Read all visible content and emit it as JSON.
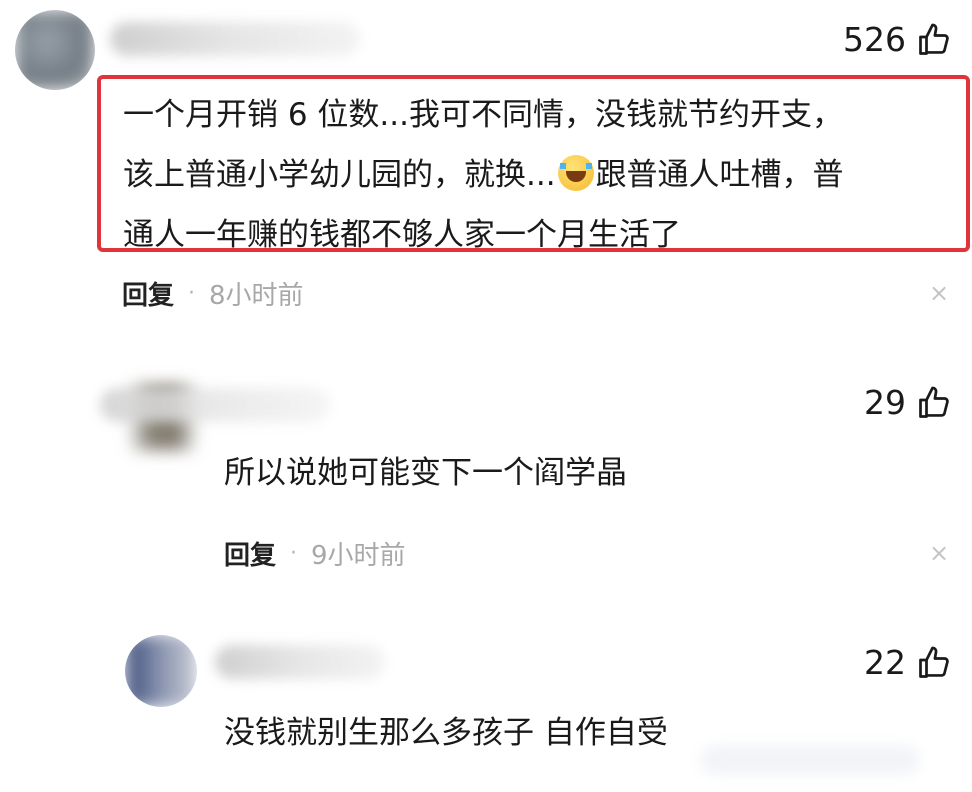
{
  "comments": [
    {
      "likes": "526",
      "text_lines": [
        "一个月开销 6 位数...我可不同情，没钱就节约开支，",
        "该上普通小学幼儿园的，就换...",
        "跟普通人吐槽，普",
        "通人一年赚的钱都不够人家一个月生活了"
      ],
      "reply_label": "回复",
      "separator": "·",
      "time": "8小时前",
      "close_glyph": "×"
    },
    {
      "likes": "29",
      "text": "所以说她可能变下一个阎学晶",
      "reply_label": "回复",
      "separator": "·",
      "time": "9小时前",
      "close_glyph": "×"
    },
    {
      "likes": "22",
      "text": "没钱就别生那么多孩子 自作自受"
    }
  ],
  "icons": {
    "like": "thumbs-up-icon",
    "close": "close-icon",
    "emoji": "laughing-tears-emoji"
  },
  "colors": {
    "highlight_border": "#e0343a",
    "time_gray": "#a8a8a8"
  }
}
